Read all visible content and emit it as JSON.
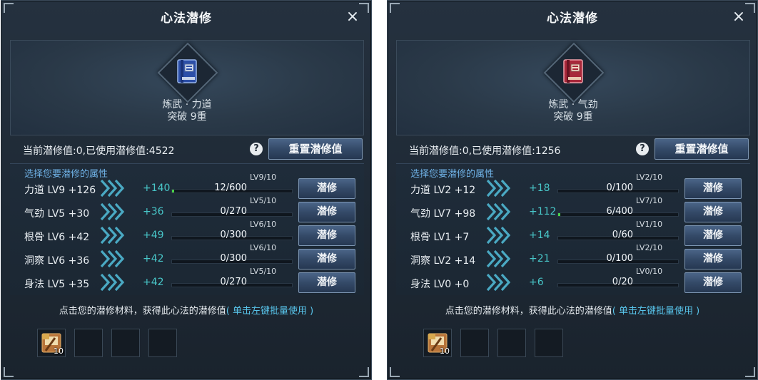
{
  "panels": [
    {
      "title": "心法潜修",
      "close_label": "×",
      "book": {
        "name": "炼武 · 力道",
        "breakthrough": "突破 9重",
        "icon": "blue-book-icon"
      },
      "points_text": "当前潜修值:0,已使用潜修值:4522",
      "help_label": "?",
      "reset_label": "重置潜修值",
      "section_label": "选择您要潜修的属性",
      "train_label": "潜修",
      "rows": [
        {
          "name": "力道 LV9 +126",
          "bonus": "+140",
          "progress": "12/600",
          "fill": 0.02,
          "level": "LV9/10"
        },
        {
          "name": "气劲 LV5 +30",
          "bonus": "+36",
          "progress": "0/270",
          "fill": 0,
          "level": "LV5/10"
        },
        {
          "name": "根骨 LV6 +42",
          "bonus": "+49",
          "progress": "0/300",
          "fill": 0,
          "level": "LV6/10"
        },
        {
          "name": "洞察 LV6 +36",
          "bonus": "+42",
          "progress": "0/300",
          "fill": 0,
          "level": "LV6/10"
        },
        {
          "name": "身法 LV5 +35",
          "bonus": "+42",
          "progress": "0/270",
          "fill": 0,
          "level": "LV5/10"
        }
      ],
      "hint": "点击您的潜修材料，获得此心法的潜修值",
      "hint_link": "( 单击左键批量使用 )",
      "materials": [
        {
          "count": "10",
          "icon": "scroll-material-icon"
        },
        null,
        null,
        null
      ]
    },
    {
      "title": "心法潜修",
      "close_label": "×",
      "book": {
        "name": "炼武 · 气劲",
        "breakthrough": "突破 9重",
        "icon": "red-book-icon"
      },
      "points_text": "当前潜修值:0,已使用潜修值:1256",
      "help_label": "?",
      "reset_label": "重置潜修值",
      "section_label": "选择您要潜修的属性",
      "train_label": "潜修",
      "rows": [
        {
          "name": "力道 LV2 +12",
          "bonus": "+18",
          "progress": "0/100",
          "fill": 0,
          "level": "LV2/10"
        },
        {
          "name": "气劲 LV7 +98",
          "bonus": "+112",
          "progress": "6/400",
          "fill": 0.015,
          "level": "LV7/10"
        },
        {
          "name": "根骨 LV1 +7",
          "bonus": "+14",
          "progress": "0/60",
          "fill": 0,
          "level": "LV1/10"
        },
        {
          "name": "洞察 LV2 +14",
          "bonus": "+21",
          "progress": "0/100",
          "fill": 0,
          "level": "LV2/10"
        },
        {
          "name": "身法 LV0 +0",
          "bonus": "+6",
          "progress": "0/20",
          "fill": 0,
          "level": "LV0/10"
        }
      ],
      "hint": "点击您的潜修材料，获得此心法的潜修值",
      "hint_link": "( 单击左键批量使用 )",
      "materials": [
        {
          "count": "10",
          "icon": "scroll-material-icon"
        },
        null,
        null,
        null
      ]
    }
  ],
  "colors": {
    "accent_text": "#58c4ea",
    "bonus": "#48c6c8",
    "progress_fill": "#4ad14a",
    "button": "#344a68"
  }
}
